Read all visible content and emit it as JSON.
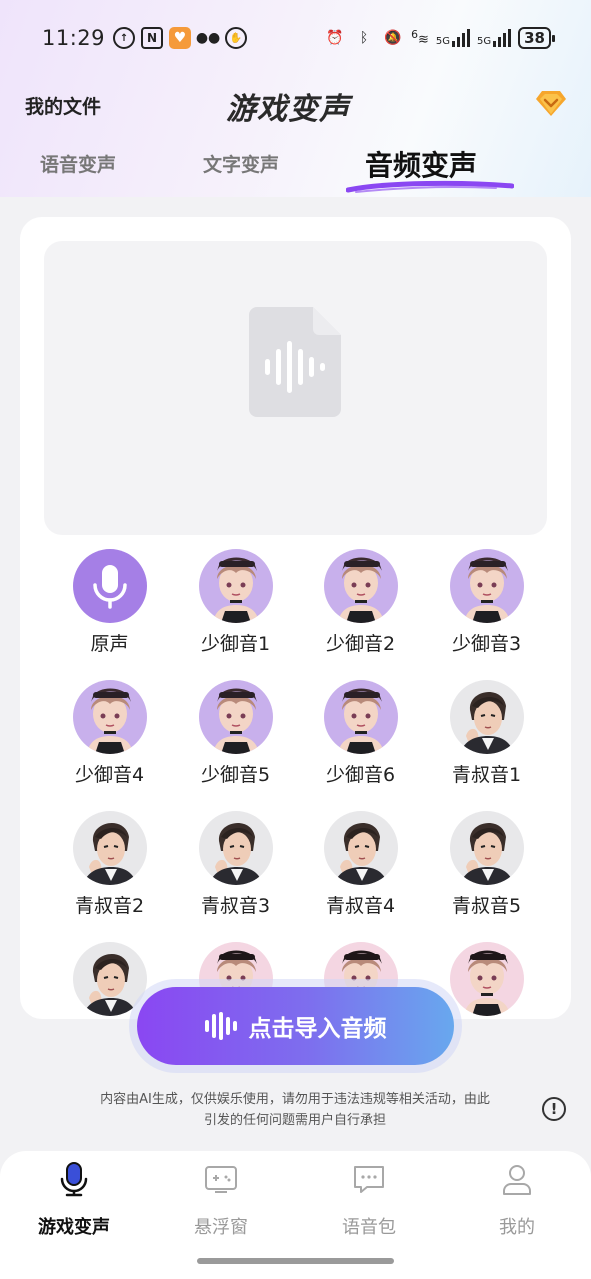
{
  "status_bar": {
    "time": "11:29",
    "battery": "38",
    "net_label_1": "5G",
    "net_label_2": "5G",
    "wifi_label": "6"
  },
  "header": {
    "my_files": "我的文件",
    "title": "游戏变声"
  },
  "tabs": [
    {
      "label": "语音变声"
    },
    {
      "label": "文字变声"
    },
    {
      "label": "音频变声",
      "active": true
    }
  ],
  "voices": [
    {
      "label": "原声",
      "type": "mic"
    },
    {
      "label": "少御音1",
      "type": "girl"
    },
    {
      "label": "少御音2",
      "type": "girl"
    },
    {
      "label": "少御音3",
      "type": "girl"
    },
    {
      "label": "少御音4",
      "type": "girl"
    },
    {
      "label": "少御音5",
      "type": "girl"
    },
    {
      "label": "少御音6",
      "type": "girl"
    },
    {
      "label": "青叔音1",
      "type": "man"
    },
    {
      "label": "青叔音2",
      "type": "man"
    },
    {
      "label": "青叔音3",
      "type": "man"
    },
    {
      "label": "青叔音4",
      "type": "man"
    },
    {
      "label": "青叔音5",
      "type": "man"
    }
  ],
  "import_button": {
    "label": "点击导入音频"
  },
  "disclaimer": {
    "line1": "内容由AI生成，仅供娱乐使用，请勿用于违法违规等相关活动，由此",
    "line2": "引发的任何问题需用户自行承担"
  },
  "bottom_nav": [
    {
      "label": "游戏变声",
      "icon": "microphone-icon",
      "active": true
    },
    {
      "label": "悬浮窗",
      "icon": "gamepad-icon"
    },
    {
      "label": "语音包",
      "icon": "chat-bubble-icon"
    },
    {
      "label": "我的",
      "icon": "person-icon"
    }
  ],
  "colors": {
    "accent_purple": "#8a47f2",
    "accent_blue": "#68a8ee",
    "girl_avatar_bg": "#c8b0ec",
    "man_avatar_bg": "#e8e8ea"
  }
}
